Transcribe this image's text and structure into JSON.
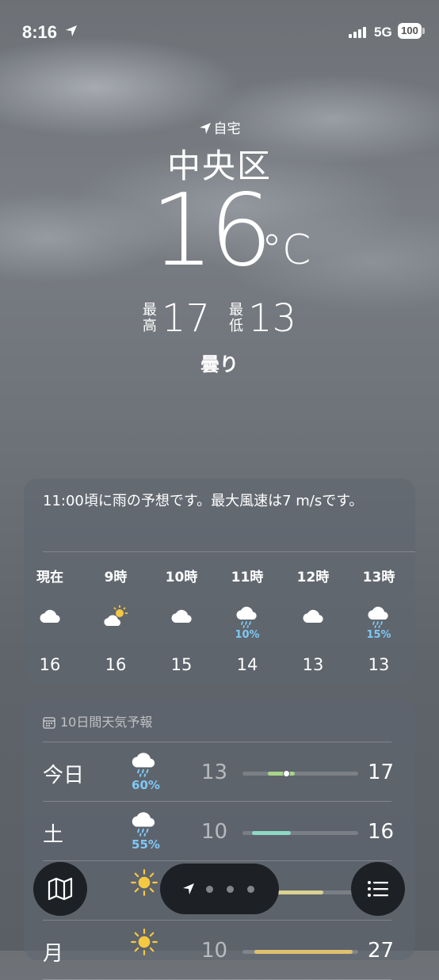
{
  "status_bar": {
    "time": "8:16",
    "network": "5G",
    "battery": "100"
  },
  "location": {
    "home_label": "自宅",
    "city": "中央区",
    "temperature": "16",
    "unit": "°C",
    "high_label_1": "最",
    "high_label_2": "高",
    "high": "17",
    "low_label_1": "最",
    "low_label_2": "低",
    "low": "13",
    "condition": "曇り"
  },
  "hourly_card": {
    "summary": "11:00頃に雨の予想です。最大風速は7 m/sです。",
    "hours": [
      {
        "label": "現在",
        "icon": "cloud-icon",
        "precip": "",
        "temp": "16"
      },
      {
        "label": "9時",
        "icon": "partly-sunny-icon",
        "precip": "",
        "temp": "16"
      },
      {
        "label": "10時",
        "icon": "cloud-icon",
        "precip": "",
        "temp": "15"
      },
      {
        "label": "11時",
        "icon": "rain-cloud-icon",
        "precip": "10%",
        "temp": "14"
      },
      {
        "label": "12時",
        "icon": "cloud-icon",
        "precip": "",
        "temp": "13"
      },
      {
        "label": "13時",
        "icon": "rain-cloud-icon",
        "precip": "15%",
        "temp": "13"
      }
    ]
  },
  "daily_card": {
    "header": "10日間天気予報",
    "days": [
      {
        "day": "今日",
        "icon": "rain-cloud-icon",
        "precip": "60%",
        "low": "13",
        "high": "17",
        "range_start": 0.22,
        "range_end": 0.45,
        "color": "#a8d48a",
        "current": 0.38
      },
      {
        "day": "土",
        "icon": "rain-cloud-icon",
        "precip": "55%",
        "low": "10",
        "high": "16",
        "range_start": 0.08,
        "range_end": 0.42,
        "color": "#8fd8c4"
      },
      {
        "day": "",
        "icon": "sun-icon",
        "precip": "",
        "low": "",
        "high": "",
        "range_start": 0.15,
        "range_end": 0.7,
        "color": "#d9d290"
      },
      {
        "day": "月",
        "icon": "sun-icon",
        "precip": "",
        "low": "10",
        "high": "27",
        "range_start": 0.1,
        "range_end": 0.95,
        "color": "#e0c070"
      }
    ]
  },
  "colors": {
    "precip": "#7fc8f5",
    "fab_bg": "#1d2126"
  },
  "bottom_bar": {
    "map_icon": "map-icon",
    "list_icon": "list-icon",
    "pages": 3
  }
}
